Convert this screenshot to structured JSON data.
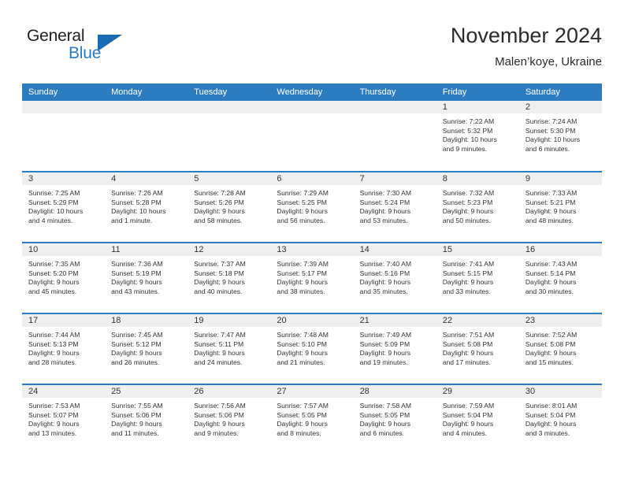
{
  "brand": {
    "name_part1": "General",
    "name_part2": "Blue",
    "triangle_color": "#1a6cb5",
    "blue_text_color": "#2b7cc0"
  },
  "header": {
    "title": "November 2024",
    "subtitle": "Malen’koye, Ukraine"
  },
  "colors": {
    "header_blue": "#2e7cc0",
    "daynum_gray": "#efefef",
    "text": "#333333"
  },
  "weekday_headers": [
    "Sunday",
    "Monday",
    "Tuesday",
    "Wednesday",
    "Thursday",
    "Friday",
    "Saturday"
  ],
  "weeks": [
    [
      {
        "day": "",
        "empty": true,
        "sunrise": "",
        "sunset": "",
        "daylight1": "",
        "daylight2": ""
      },
      {
        "day": "",
        "empty": true,
        "sunrise": "",
        "sunset": "",
        "daylight1": "",
        "daylight2": ""
      },
      {
        "day": "",
        "empty": true,
        "sunrise": "",
        "sunset": "",
        "daylight1": "",
        "daylight2": ""
      },
      {
        "day": "",
        "empty": true,
        "sunrise": "",
        "sunset": "",
        "daylight1": "",
        "daylight2": ""
      },
      {
        "day": "",
        "empty": true,
        "sunrise": "",
        "sunset": "",
        "daylight1": "",
        "daylight2": ""
      },
      {
        "day": "1",
        "empty": false,
        "sunrise": "Sunrise: 7:22 AM",
        "sunset": "Sunset: 5:32 PM",
        "daylight1": "Daylight: 10 hours",
        "daylight2": "and 9 minutes."
      },
      {
        "day": "2",
        "empty": false,
        "sunrise": "Sunrise: 7:24 AM",
        "sunset": "Sunset: 5:30 PM",
        "daylight1": "Daylight: 10 hours",
        "daylight2": "and 6 minutes."
      }
    ],
    [
      {
        "day": "3",
        "empty": false,
        "sunrise": "Sunrise: 7:25 AM",
        "sunset": "Sunset: 5:29 PM",
        "daylight1": "Daylight: 10 hours",
        "daylight2": "and 4 minutes."
      },
      {
        "day": "4",
        "empty": false,
        "sunrise": "Sunrise: 7:26 AM",
        "sunset": "Sunset: 5:28 PM",
        "daylight1": "Daylight: 10 hours",
        "daylight2": "and 1 minute."
      },
      {
        "day": "5",
        "empty": false,
        "sunrise": "Sunrise: 7:28 AM",
        "sunset": "Sunset: 5:26 PM",
        "daylight1": "Daylight: 9 hours",
        "daylight2": "and 58 minutes."
      },
      {
        "day": "6",
        "empty": false,
        "sunrise": "Sunrise: 7:29 AM",
        "sunset": "Sunset: 5:25 PM",
        "daylight1": "Daylight: 9 hours",
        "daylight2": "and 56 minutes."
      },
      {
        "day": "7",
        "empty": false,
        "sunrise": "Sunrise: 7:30 AM",
        "sunset": "Sunset: 5:24 PM",
        "daylight1": "Daylight: 9 hours",
        "daylight2": "and 53 minutes."
      },
      {
        "day": "8",
        "empty": false,
        "sunrise": "Sunrise: 7:32 AM",
        "sunset": "Sunset: 5:23 PM",
        "daylight1": "Daylight: 9 hours",
        "daylight2": "and 50 minutes."
      },
      {
        "day": "9",
        "empty": false,
        "sunrise": "Sunrise: 7:33 AM",
        "sunset": "Sunset: 5:21 PM",
        "daylight1": "Daylight: 9 hours",
        "daylight2": "and 48 minutes."
      }
    ],
    [
      {
        "day": "10",
        "empty": false,
        "sunrise": "Sunrise: 7:35 AM",
        "sunset": "Sunset: 5:20 PM",
        "daylight1": "Daylight: 9 hours",
        "daylight2": "and 45 minutes."
      },
      {
        "day": "11",
        "empty": false,
        "sunrise": "Sunrise: 7:36 AM",
        "sunset": "Sunset: 5:19 PM",
        "daylight1": "Daylight: 9 hours",
        "daylight2": "and 43 minutes."
      },
      {
        "day": "12",
        "empty": false,
        "sunrise": "Sunrise: 7:37 AM",
        "sunset": "Sunset: 5:18 PM",
        "daylight1": "Daylight: 9 hours",
        "daylight2": "and 40 minutes."
      },
      {
        "day": "13",
        "empty": false,
        "sunrise": "Sunrise: 7:39 AM",
        "sunset": "Sunset: 5:17 PM",
        "daylight1": "Daylight: 9 hours",
        "daylight2": "and 38 minutes."
      },
      {
        "day": "14",
        "empty": false,
        "sunrise": "Sunrise: 7:40 AM",
        "sunset": "Sunset: 5:16 PM",
        "daylight1": "Daylight: 9 hours",
        "daylight2": "and 35 minutes."
      },
      {
        "day": "15",
        "empty": false,
        "sunrise": "Sunrise: 7:41 AM",
        "sunset": "Sunset: 5:15 PM",
        "daylight1": "Daylight: 9 hours",
        "daylight2": "and 33 minutes."
      },
      {
        "day": "16",
        "empty": false,
        "sunrise": "Sunrise: 7:43 AM",
        "sunset": "Sunset: 5:14 PM",
        "daylight1": "Daylight: 9 hours",
        "daylight2": "and 30 minutes."
      }
    ],
    [
      {
        "day": "17",
        "empty": false,
        "sunrise": "Sunrise: 7:44 AM",
        "sunset": "Sunset: 5:13 PM",
        "daylight1": "Daylight: 9 hours",
        "daylight2": "and 28 minutes."
      },
      {
        "day": "18",
        "empty": false,
        "sunrise": "Sunrise: 7:45 AM",
        "sunset": "Sunset: 5:12 PM",
        "daylight1": "Daylight: 9 hours",
        "daylight2": "and 26 minutes."
      },
      {
        "day": "19",
        "empty": false,
        "sunrise": "Sunrise: 7:47 AM",
        "sunset": "Sunset: 5:11 PM",
        "daylight1": "Daylight: 9 hours",
        "daylight2": "and 24 minutes."
      },
      {
        "day": "20",
        "empty": false,
        "sunrise": "Sunrise: 7:48 AM",
        "sunset": "Sunset: 5:10 PM",
        "daylight1": "Daylight: 9 hours",
        "daylight2": "and 21 minutes."
      },
      {
        "day": "21",
        "empty": false,
        "sunrise": "Sunrise: 7:49 AM",
        "sunset": "Sunset: 5:09 PM",
        "daylight1": "Daylight: 9 hours",
        "daylight2": "and 19 minutes."
      },
      {
        "day": "22",
        "empty": false,
        "sunrise": "Sunrise: 7:51 AM",
        "sunset": "Sunset: 5:08 PM",
        "daylight1": "Daylight: 9 hours",
        "daylight2": "and 17 minutes."
      },
      {
        "day": "23",
        "empty": false,
        "sunrise": "Sunrise: 7:52 AM",
        "sunset": "Sunset: 5:08 PM",
        "daylight1": "Daylight: 9 hours",
        "daylight2": "and 15 minutes."
      }
    ],
    [
      {
        "day": "24",
        "empty": false,
        "sunrise": "Sunrise: 7:53 AM",
        "sunset": "Sunset: 5:07 PM",
        "daylight1": "Daylight: 9 hours",
        "daylight2": "and 13 minutes."
      },
      {
        "day": "25",
        "empty": false,
        "sunrise": "Sunrise: 7:55 AM",
        "sunset": "Sunset: 5:06 PM",
        "daylight1": "Daylight: 9 hours",
        "daylight2": "and 11 minutes."
      },
      {
        "day": "26",
        "empty": false,
        "sunrise": "Sunrise: 7:56 AM",
        "sunset": "Sunset: 5:06 PM",
        "daylight1": "Daylight: 9 hours",
        "daylight2": "and 9 minutes."
      },
      {
        "day": "27",
        "empty": false,
        "sunrise": "Sunrise: 7:57 AM",
        "sunset": "Sunset: 5:05 PM",
        "daylight1": "Daylight: 9 hours",
        "daylight2": "and 8 minutes."
      },
      {
        "day": "28",
        "empty": false,
        "sunrise": "Sunrise: 7:58 AM",
        "sunset": "Sunset: 5:05 PM",
        "daylight1": "Daylight: 9 hours",
        "daylight2": "and 6 minutes."
      },
      {
        "day": "29",
        "empty": false,
        "sunrise": "Sunrise: 7:59 AM",
        "sunset": "Sunset: 5:04 PM",
        "daylight1": "Daylight: 9 hours",
        "daylight2": "and 4 minutes."
      },
      {
        "day": "30",
        "empty": false,
        "sunrise": "Sunrise: 8:01 AM",
        "sunset": "Sunset: 5:04 PM",
        "daylight1": "Daylight: 9 hours",
        "daylight2": "and 3 minutes."
      }
    ]
  ]
}
